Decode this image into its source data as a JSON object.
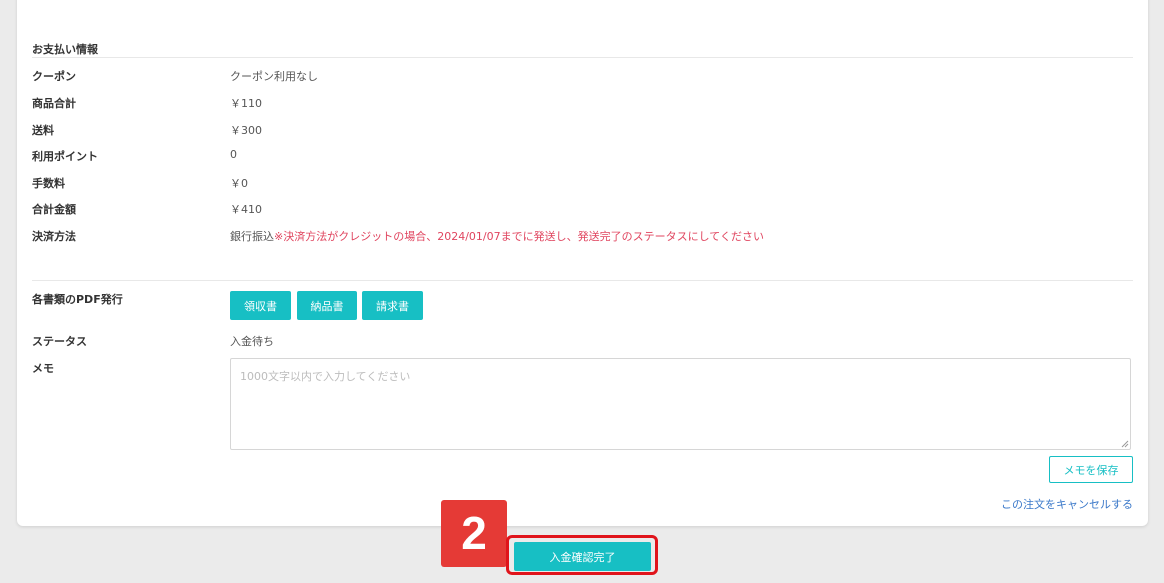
{
  "payment": {
    "section_title": "お支払い情報",
    "coupon_label": "クーポン",
    "coupon_value": "クーポン利用なし",
    "subtotal_label": "商品合計",
    "subtotal_value": "￥110",
    "shipping_label": "送料",
    "shipping_value": "￥300",
    "points_label": "利用ポイント",
    "points_value": "0",
    "fee_label": "手数料",
    "fee_value": "￥0",
    "total_label": "合計金額",
    "total_value": "￥410",
    "method_label": "決済方法",
    "method_value": "銀行振込",
    "method_warning": "※決済方法がクレジットの場合、2024/01/07までに発送し、発送完了のステータスにしてください"
  },
  "documents": {
    "label": "各書類のPDF発行",
    "buttons": [
      "領収書",
      "納品書",
      "請求書"
    ]
  },
  "status": {
    "label": "ステータス",
    "value": "入金待ち"
  },
  "memo": {
    "label": "メモ",
    "placeholder": "1000文字以内で入力してください",
    "save_label": "メモを保存"
  },
  "cancel_link": "この注文をキャンセルする",
  "step_badge": "2",
  "confirm_button": "入金確認完了",
  "colors": {
    "accent": "#17bfc4",
    "warning": "#e0455f",
    "link": "#3a78c9",
    "highlight": "#e0141b"
  }
}
